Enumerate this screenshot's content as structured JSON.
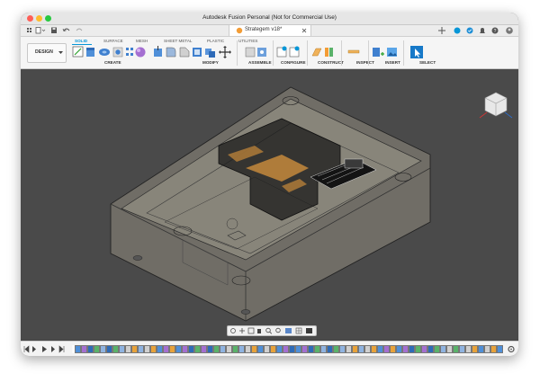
{
  "window": {
    "title": "Autodesk Fusion Personal (Not for Commercial Use)"
  },
  "document_tab": {
    "title": "Strategem v18*"
  },
  "workspace": {
    "label": "DESIGN"
  },
  "ribbon_tabs": [
    "SOLID",
    "SURFACE",
    "MESH",
    "SHEET METAL",
    "PLASTIC",
    "UTILITIES"
  ],
  "active_tab": "SOLID",
  "groups": {
    "create": "CREATE",
    "modify": "MODIFY",
    "assemble": "ASSEMBLE",
    "configure": "CONFIGURE",
    "construct": "CONSTRUCT",
    "inspect": "INSPECT",
    "insert": "INSERT",
    "select": "SELECT"
  },
  "colors": {
    "accent": "#0696d7",
    "active_tab": "#0696d7",
    "viewport_bg": "#4a4a4a",
    "timeline_marker": "#e03c5a"
  },
  "icons": [
    "grid-icon",
    "file-icon",
    "save-icon",
    "undo-icon",
    "redo-icon",
    "close-icon",
    "add-tab-icon",
    "extensions-icon",
    "job-status-icon",
    "notifications-icon",
    "help-icon",
    "profile-icon",
    "viewcube-icon",
    "orbit-icon",
    "pan-icon",
    "zoom-icon",
    "display-settings-icon",
    "grid-settings-icon",
    "viewports-icon",
    "settings-icon"
  ]
}
